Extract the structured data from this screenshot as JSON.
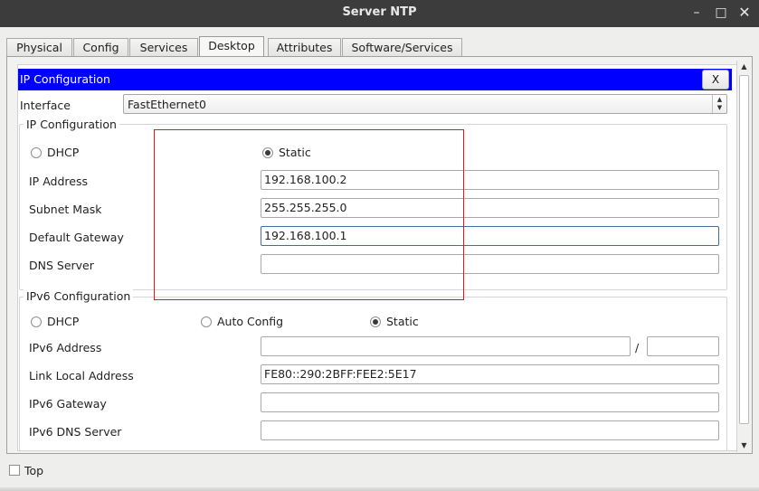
{
  "window": {
    "title": "Server NTP",
    "minimize_glyph": "–",
    "maximize_glyph": "□",
    "close_glyph": "✕"
  },
  "tabs": [
    {
      "label": "Physical",
      "active": false
    },
    {
      "label": "Config",
      "active": false
    },
    {
      "label": "Services",
      "active": false
    },
    {
      "label": "Desktop",
      "active": true
    },
    {
      "label": "Attributes",
      "active": false
    },
    {
      "label": "Software/Services",
      "active": false
    }
  ],
  "ip_config": {
    "header_title": "IP Configuration",
    "close_label": "X",
    "interface_label": "Interface",
    "interface_value": "FastEthernet0",
    "ipv4": {
      "group_title": "IP Configuration",
      "dhcp_label": "DHCP",
      "static_label": "Static",
      "mode": "static",
      "fields": [
        {
          "label": "IP Address",
          "value": "192.168.100.2"
        },
        {
          "label": "Subnet Mask",
          "value": "255.255.255.0"
        },
        {
          "label": "Default Gateway",
          "value": "192.168.100.1"
        },
        {
          "label": "DNS Server",
          "value": ""
        }
      ]
    },
    "ipv6": {
      "group_title": "IPv6 Configuration",
      "dhcp_label": "DHCP",
      "auto_label": "Auto Config",
      "static_label": "Static",
      "mode": "static",
      "address_label": "IPv6 Address",
      "address_value": "",
      "prefix_separator": "/",
      "prefix_value": "",
      "link_local_label": "Link Local Address",
      "link_local_value": "FE80::290:2BFF:FEE2:5E17",
      "gateway_label": "IPv6 Gateway",
      "gateway_value": "",
      "dns_label": "IPv6 DNS Server",
      "dns_value": ""
    }
  },
  "footer": {
    "top_label": "Top",
    "top_checked": false
  },
  "colors": {
    "header_blue": "#0000ff",
    "highlight_red": "#e01818",
    "titlebar": "#3c3c3c"
  }
}
